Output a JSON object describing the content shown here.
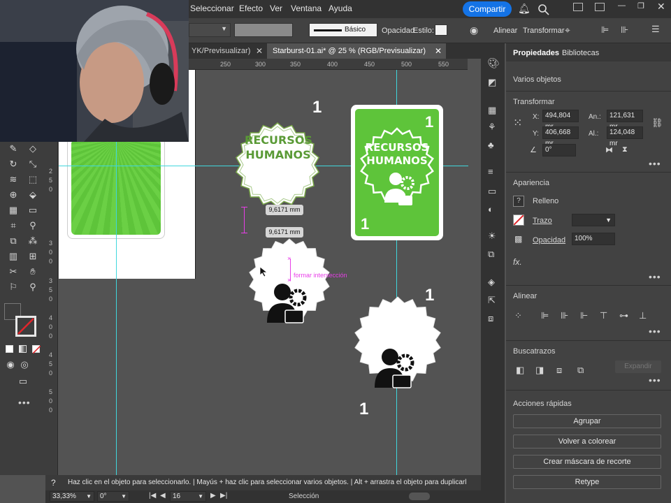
{
  "menu": {
    "items": [
      "Seleccionar",
      "Efecto",
      "Ver",
      "Ventana",
      "Ayuda"
    ],
    "share_label": "Compartir"
  },
  "control_bar": {
    "stroke_style": "Básico",
    "opacity_label": "Opacidad",
    "style_label": "Estilo:",
    "align_label": "Alinear",
    "transform_label": "Transformar"
  },
  "tabs": [
    {
      "label": "YK/Previsualizar)",
      "active": false
    },
    {
      "label": "Starburst-01.ai* @ 25 % (RGB/Previsualizar)",
      "active": true
    }
  ],
  "ruler": {
    "top_ticks": [
      "250",
      "300",
      "350",
      "400",
      "450",
      "500",
      "550"
    ],
    "left_ticks": [
      "2 5 0",
      "3 0 0",
      "3 5 0",
      "4 0 0",
      "4 5 0",
      "5 0 0"
    ]
  },
  "canvas": {
    "badge_text_line1": "RECURSOS",
    "badge_text_line2": "HUMANOS",
    "card_text_line1": "RECURSOS",
    "card_text_line2": "HUMANOS",
    "number_one": "1",
    "measure_label_1": "9,6171 mm",
    "measure_label_2": "9,6171 mm",
    "smart_guide_label": "formar intersección",
    "green": "#5ec43a",
    "guide_color": "#3fd7dd",
    "smart_guide_color": "#e83ee8"
  },
  "properties": {
    "tab_properties": "Propiedades",
    "tab_libraries": "Bibliotecas",
    "selection_type": "Varios objetos",
    "transform_title": "Transformar",
    "x_label": "X:",
    "x_value": "494,804 mr",
    "y_label": "Y:",
    "y_value": "406,668 mr",
    "w_label": "An.:",
    "w_value": "121,631 mr",
    "h_label": "Al.:",
    "h_value": "124,048 mr",
    "angle_value": "0°",
    "appearance_title": "Apariencia",
    "fill_label": "Relleno",
    "stroke_label": "Trazo",
    "opacity_label": "Opacidad",
    "opacity_value": "100%",
    "align_title": "Alinear",
    "pathfinder_title": "Buscatrazos",
    "expand_label": "Expandir",
    "quick_actions_title": "Acciones rápidas",
    "qa_buttons": [
      "Agrupar",
      "Volver a colorear",
      "Crear máscara de recorte",
      "Retype"
    ]
  },
  "status": {
    "hint": "Haz clic en el objeto para seleccionarlo.  |  Mayús + haz clic para seleccionar varios objetos.  |  Alt + arrastra el objeto para duplicarl",
    "zoom": "33,33%",
    "rotation": "0°",
    "artboard": "16",
    "tool_name": "Selección"
  }
}
